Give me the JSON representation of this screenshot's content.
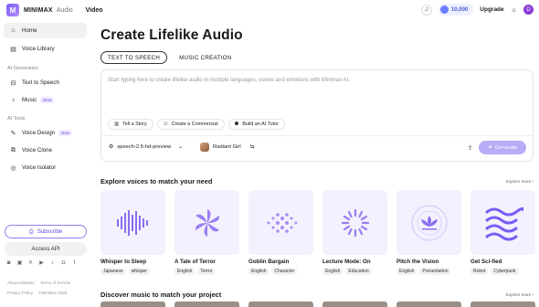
{
  "app": {
    "brand": "MINIMAX",
    "brand_sub": "Audio",
    "nav_video": "Video",
    "logo_glyph": "M"
  },
  "top": {
    "credits": "10,000",
    "upgrade": "Upgrade",
    "avatar_initial": "D"
  },
  "sidebar": {
    "items_top": [
      {
        "label": "Home",
        "icon": "home-icon"
      },
      {
        "label": "Voice Library",
        "icon": "library-icon"
      }
    ],
    "section_generation": "AI Generation",
    "items_gen": [
      {
        "label": "Text to Speech",
        "icon": "speech-icon"
      },
      {
        "label": "Music",
        "icon": "music-icon",
        "badge": "Beta"
      }
    ],
    "section_tools": "AI Tools",
    "items_tools": [
      {
        "label": "Voice Design",
        "icon": "voice-design-icon",
        "badge": "New"
      },
      {
        "label": "Voice Clone",
        "icon": "voice-clone-icon"
      },
      {
        "label": "Voice Isolator",
        "icon": "isolator-icon"
      }
    ],
    "subscribe": "Subscribe",
    "access_api": "Access API",
    "footer1": [
      "About MiniMax",
      "Terms of Service"
    ],
    "footer2": [
      "Privacy Policy",
      "©MiniMax 2025"
    ]
  },
  "main": {
    "title": "Create Lifelike Audio",
    "tabs": [
      "TEXT TO SPEECH",
      "MUSIC CREATION"
    ],
    "placeholder": "Start typing here to create lifelike audio in multiple languages, voices and emotions with Minimax AI.",
    "chips": [
      "Tell a Story",
      "Create a Commercial",
      "Build an AI Tutor"
    ],
    "model": "speech-2.5-hd-preview",
    "voice": "Radiant Girl",
    "generate": "Generate"
  },
  "explore": {
    "title": "Explore voices to match your need",
    "more": "Explore more",
    "cards": [
      {
        "title": "Whisper to Sleep",
        "tags": [
          "Japanese",
          "whisper"
        ]
      },
      {
        "title": "A Tale of Terror",
        "tags": [
          "English",
          "Terror"
        ]
      },
      {
        "title": "Goblin Bargain",
        "tags": [
          "English",
          "Character"
        ]
      },
      {
        "title": "Lecture Mode: On",
        "tags": [
          "English",
          "Education"
        ]
      },
      {
        "title": "Pitch the Vision",
        "tags": [
          "English",
          "Presentation"
        ]
      },
      {
        "title": "Get Sci-fied",
        "tags": [
          "Robot",
          "Cyberpunk"
        ]
      }
    ]
  },
  "music": {
    "title": "Discover music to match your project",
    "more": "Explore more"
  },
  "colors": {
    "accent": "#7b5cf5",
    "generate_bg": "#b8acf6",
    "card_bg": "#f3f1fd"
  }
}
